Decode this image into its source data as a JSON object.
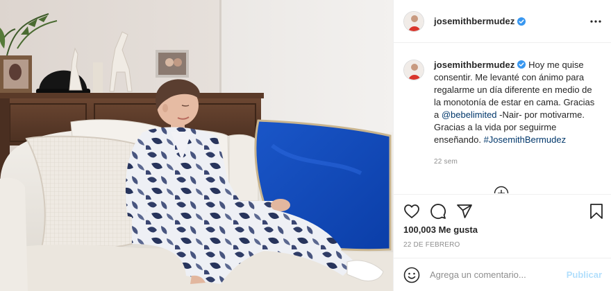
{
  "post": {
    "username": "josemithbermudez",
    "verified": true,
    "caption": {
      "line_1": "Hoy me quise consentir. Me levanté con ánimo para regalarme un día diferente en medio de la monotonía de estar en cama. Gracias a ",
      "mention": "@bebelimited",
      "line_2": " -Nair- por motivarme. Gracias a la vida por seguirme enseñando. ",
      "hashtag": "#JosemithBermudez"
    },
    "time_ago": "22 sem",
    "likes": "100,003 Me gusta",
    "date": "22 DE FEBRERO"
  },
  "comment_box": {
    "placeholder": "Agrega un comentario...",
    "post_label": "Publicar"
  },
  "icons": {
    "verified": "verified-badge-icon",
    "more": "more-options-icon",
    "load_more": "load-more-comments-icon",
    "like": "heart-icon",
    "comment": "comment-bubble-icon",
    "share": "paper-plane-icon",
    "save": "bookmark-icon",
    "emoji": "emoji-smile-icon"
  },
  "colors": {
    "verified_blue": "#3897f0",
    "link": "#00376b",
    "muted": "#8e8e8e",
    "post_button_disabled": "#b2dffc"
  }
}
